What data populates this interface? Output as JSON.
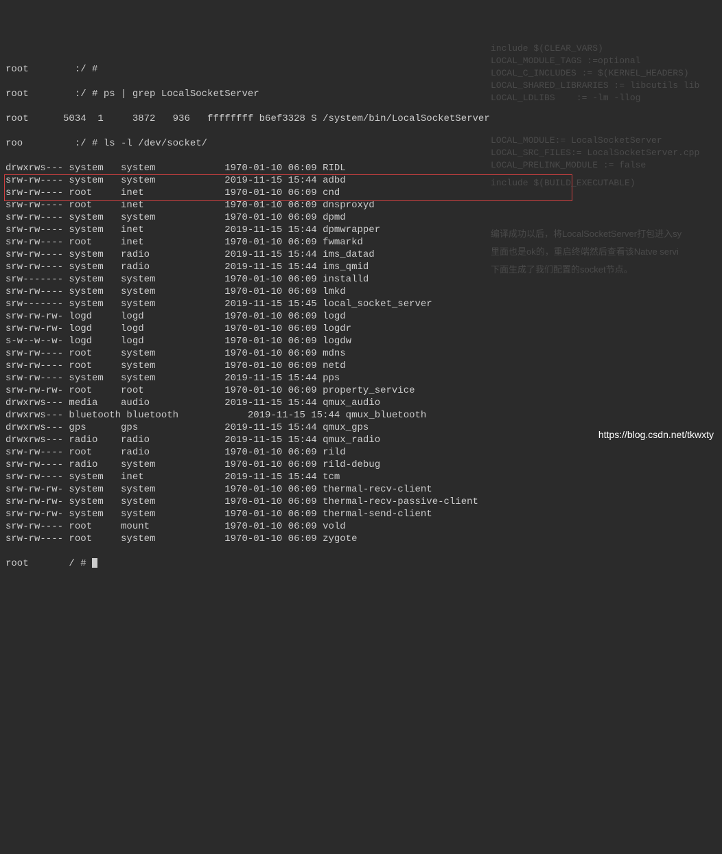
{
  "prompt1": "root        :/ #",
  "prompt2": "root        :/ # ps | grep LocalSocketServer",
  "psLine": "root      5034  1     3872   936   ffffffff b6ef3328 S /system/bin/LocalSocketServer",
  "prompt3": "roo         :/ # ls -l /dev/socket/",
  "lines": [
    "drwxrws--- system   system            1970-01-10 06:09 RIDL",
    "srw-rw---- system   system            2019-11-15 15:44 adbd",
    "srw-rw---- root     inet              1970-01-10 06:09 cnd",
    "srw-rw---- root     inet              1970-01-10 06:09 dnsproxyd",
    "srw-rw---- system   system            1970-01-10 06:09 dpmd",
    "srw-rw---- system   inet              2019-11-15 15:44 dpmwrapper",
    "srw-rw---- root     inet              1970-01-10 06:09 fwmarkd",
    "srw-rw---- system   radio             2019-11-15 15:44 ims_datad",
    "srw-rw---- system   radio             2019-11-15 15:44 ims_qmid",
    "srw------- system   system            1970-01-10 06:09 installd",
    "srw-rw---- system   system            1970-01-10 06:09 lmkd",
    "srw------- system   system            2019-11-15 15:45 local_socket_server",
    "srw-rw-rw- logd     logd              1970-01-10 06:09 logd",
    "srw-rw-rw- logd     logd              1970-01-10 06:09 logdr",
    "s-w--w--w- logd     logd              1970-01-10 06:09 logdw",
    "srw-rw---- root     system            1970-01-10 06:09 mdns",
    "srw-rw---- root     system            1970-01-10 06:09 netd",
    "srw-rw---- system   system            2019-11-15 15:44 pps",
    "srw-rw-rw- root     root              1970-01-10 06:09 property_service",
    "drwxrws--- media    audio             2019-11-15 15:44 qmux_audio",
    "drwxrws--- bluetooth bluetooth            2019-11-15 15:44 qmux_bluetooth",
    "drwxrws--- gps      gps               2019-11-15 15:44 qmux_gps",
    "drwxrws--- radio    radio             2019-11-15 15:44 qmux_radio",
    "srw-rw---- root     radio             1970-01-10 06:09 rild",
    "srw-rw---- radio    system            1970-01-10 06:09 rild-debug",
    "srw-rw---- system   inet              2019-11-15 15:44 tcm",
    "srw-rw-rw- system   system            1970-01-10 06:09 thermal-recv-client",
    "srw-rw-rw- system   system            1970-01-10 06:09 thermal-recv-passive-client",
    "srw-rw-rw- system   system            1970-01-10 06:09 thermal-send-client",
    "srw-rw---- root     mount             1970-01-10 06:09 vold",
    "srw-rw---- root     system            1970-01-10 06:09 zygote"
  ],
  "prompt4": "root       / # ",
  "watermark": "https://blog.csdn.net/tkwxty",
  "ghosts": {
    "g1": "include $(CLEAR_VARS)",
    "g2": "LOCAL_MODULE_TAGS :=optional",
    "g3": "LOCAL_C_INCLUDES := $(KERNEL_HEADERS)",
    "g4": "LOCAL_SHARED_LIBRARIES := libcutils lib",
    "g5": "LOCAL_LDLIBS    := -lm -llog",
    "g7": "LOCAL_MODULE:= LocalSocketServer",
    "g8": "LOCAL_SRC_FILES:= LocalSocketServer.cpp",
    "g9": "LOCAL_PRELINK_MODULE := false",
    "g10": "include $(BUILD_EXECUTABLE)",
    "g11": "编译成功以后，将LocalSocketServer打包进入sy",
    "g12": "里面也是ok的，重启终端然后查看该Natve servi",
    "g13": "下面生成了我们配置的socket节点。"
  }
}
